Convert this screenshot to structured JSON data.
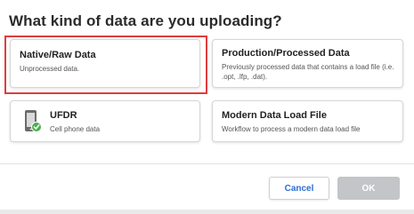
{
  "dialog": {
    "title": "What kind of data are you uploading?"
  },
  "options": [
    {
      "title": "Native/Raw Data",
      "description": "Unprocessed data.",
      "selected": true
    },
    {
      "title": "Production/Processed Data",
      "description": "Previously processed data that contains a load file (i.e. .opt, .lfp, .dat)."
    },
    {
      "title": "UFDR",
      "description": "Cell phone data",
      "icon": "phone-check-icon"
    },
    {
      "title": "Modern Data Load File",
      "description": "Workflow to process a modern data load file"
    }
  ],
  "actions": {
    "cancel_label": "Cancel",
    "ok_label": "OK"
  },
  "colors": {
    "highlight": "#e03c3c",
    "cancel_text": "#2a6fd6",
    "ok_disabled": "#c3c5c8",
    "phone_check": "#4caf50"
  }
}
